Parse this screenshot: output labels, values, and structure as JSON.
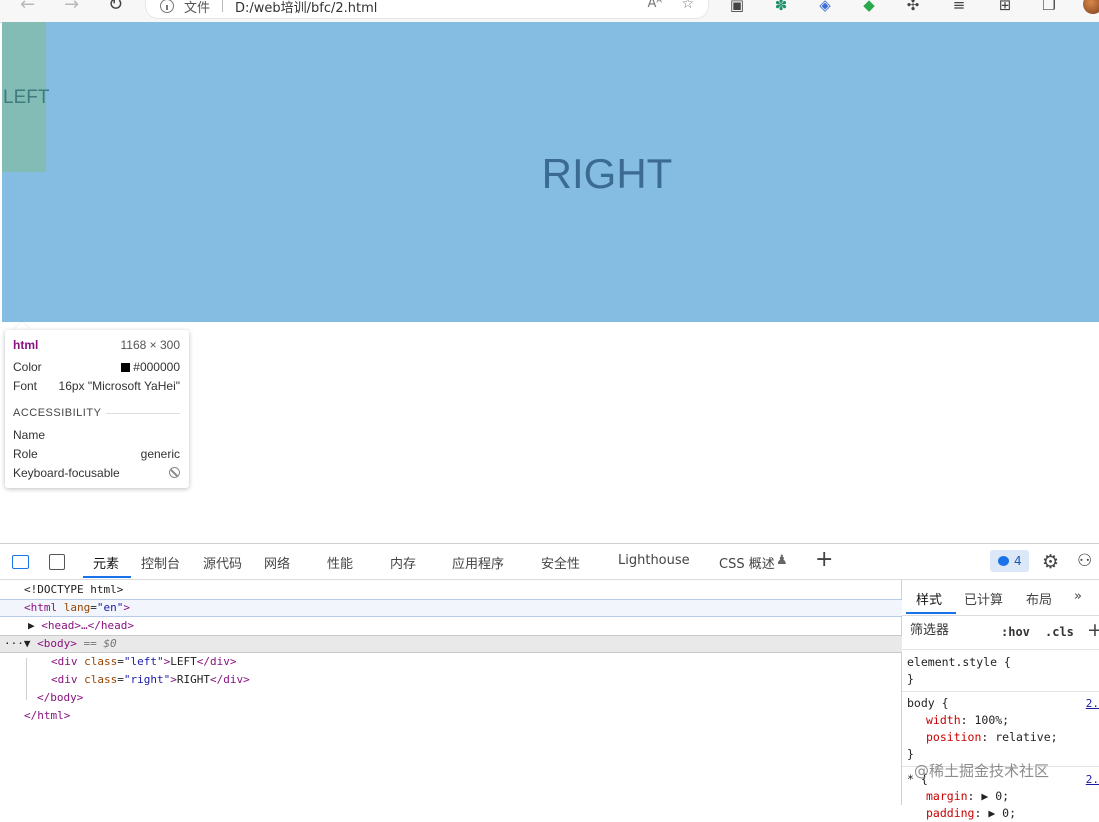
{
  "browser": {
    "file_label": "文件",
    "url": "D:/web培训/bfc/2.html",
    "read_aloud_label": "Aᴬ"
  },
  "page": {
    "left_text": "LEFT",
    "right_text": "RIGHT",
    "left_color": "#83bcb5",
    "right_color": "#85bde2"
  },
  "tooltip": {
    "tag": "html",
    "size": "1168 × 300",
    "color_label": "Color",
    "color_value": "#000000",
    "font_label": "Font",
    "font_value": "16px \"Microsoft YaHei\"",
    "accessibility_title": "ACCESSIBILITY",
    "name_label": "Name",
    "role_label": "Role",
    "role_value": "generic",
    "focusable_label": "Keyboard-focusable"
  },
  "devtools": {
    "tabs": [
      "元素",
      "控制台",
      "源代码",
      "网络",
      "性能",
      "内存",
      "应用程序",
      "安全性",
      "Lighthouse",
      "CSS 概述"
    ],
    "issues_count": "4",
    "dom": {
      "doctype": "<!DOCTYPE html>",
      "html_open_tag": "<html",
      "html_attr": "lang",
      "html_attr_val": "\"en\"",
      "head_collapsed": "<head>…</head>",
      "body_open": "<body>",
      "body_marker": "== $0",
      "left_div_class": "\"left\"",
      "left_div_text": "LEFT",
      "right_div_class": "\"right\"",
      "right_div_text": "RIGHT",
      "body_close": "</body>",
      "html_close": "</html>"
    },
    "styles": {
      "tabs": [
        "样式",
        "已计算",
        "布局"
      ],
      "filter_placeholder": "筛选器",
      "hov": ":hov",
      "cls": ".cls",
      "element_style": "element.style {",
      "close_brace": "}",
      "body_selector": "body {",
      "width_prop": "width",
      "width_val": "100%;",
      "position_prop": "position",
      "position_val": "relative;",
      "source_link": "2.",
      "universal_selector": "* {",
      "margin_prop": "margin",
      "margin_val": "0;",
      "padding_prop": "padding",
      "padding_val": "0;"
    }
  },
  "watermark": "@稀土掘金技术社区"
}
